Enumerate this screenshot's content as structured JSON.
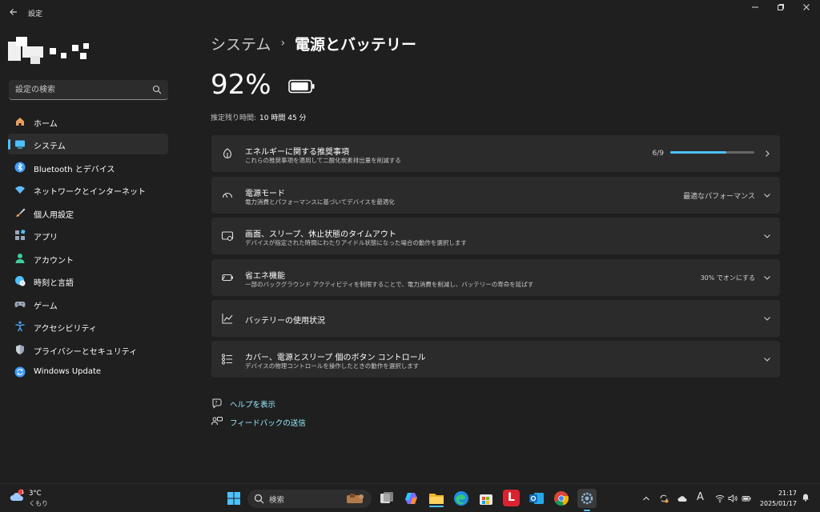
{
  "window": {
    "title": "設定",
    "back_icon": "back-arrow-icon",
    "controls": [
      "minimize-icon",
      "restore-icon",
      "close-icon"
    ]
  },
  "sidebar": {
    "search_placeholder": "設定の検索",
    "items": [
      {
        "label": "ホーム",
        "icon": "home-icon",
        "color": "#e8a060"
      },
      {
        "label": "システム",
        "icon": "system-icon",
        "color": "#4cc2ff",
        "active": true
      },
      {
        "label": "Bluetooth とデバイス",
        "icon": "bluetooth-icon",
        "color": "#3b9cff"
      },
      {
        "label": "ネットワークとインターネット",
        "icon": "wifi-icon",
        "color": "#5dbcff"
      },
      {
        "label": "個人用設定",
        "icon": "brush-icon",
        "color": "#e0a060"
      },
      {
        "label": "アプリ",
        "icon": "apps-icon",
        "color": "#9aa8b8"
      },
      {
        "label": "アカウント",
        "icon": "account-icon",
        "color": "#3ecf9e"
      },
      {
        "label": "時刻と言語",
        "icon": "globe-clock-icon",
        "color": "#4cc2ff"
      },
      {
        "label": "ゲーム",
        "icon": "gamepad-icon",
        "color": "#9aa8b8"
      },
      {
        "label": "アクセシビリティ",
        "icon": "accessibility-icon",
        "color": "#4ca8ff"
      },
      {
        "label": "プライバシーとセキュリティ",
        "icon": "shield-icon",
        "color": "#9aa8b8"
      },
      {
        "label": "Windows Update",
        "icon": "update-icon",
        "color": "#3b9cff"
      }
    ]
  },
  "breadcrumb": {
    "parent": "システム",
    "separator": "›",
    "current": "電源とバッテリー"
  },
  "battery": {
    "percent": "92%",
    "level": 0.92,
    "remaining_label": "推定残り時間:",
    "remaining_value": "10 時間 45 分"
  },
  "cards": [
    {
      "title": "エネルギーに関する推奨事項",
      "subtitle": "これらの推奨事項を適用して二酸化炭素排出量を削減する",
      "icon": "leaf-icon",
      "value": "6/9",
      "progress": 0.667,
      "chevron": "chevron-right-icon"
    },
    {
      "title": "電源モード",
      "subtitle": "電力消費とパフォーマンスに基づいてデバイスを最適化",
      "icon": "power-mode-icon",
      "value": "最適なパフォーマンス",
      "chevron": "chevron-down-icon"
    },
    {
      "title": "画面、スリープ、休止状態のタイムアウト",
      "subtitle": "デバイスが指定された時間にわたりアイドル状態になった場合の動作を選択します",
      "icon": "screen-timeout-icon",
      "chevron": "chevron-down-icon"
    },
    {
      "title": "省エネ機能",
      "subtitle": "一部のバックグラウンド アクティビティを制限することで、電力消費を削減し、バッテリーの寿命を延ばす",
      "icon": "battery-saver-icon",
      "value": "30% でオンにする",
      "chevron": "chevron-down-icon"
    },
    {
      "title": "バッテリーの使用状況",
      "icon": "chart-line-icon",
      "chevron": "chevron-down-icon"
    },
    {
      "title": "カバー、電源とスリープ 個のボタン コントロール",
      "subtitle": "デバイスの物理コントロールを操作したときの動作を選択します",
      "icon": "button-controls-icon",
      "chevron": "chevron-down-icon"
    }
  ],
  "links": [
    {
      "label": "ヘルプを表示",
      "icon": "help-icon"
    },
    {
      "label": "フィードバックの送信",
      "icon": "feedback-icon"
    }
  ],
  "taskbar": {
    "weather": {
      "temp": "3°C",
      "condition": "くもり",
      "badge": "1"
    },
    "search_label": "検索",
    "apps": [
      "start-icon",
      "search-icon",
      "widgets-icon",
      "task-view-icon",
      "copilot-icon",
      "file-explorer-icon",
      "edge-icon",
      "store-icon",
      "app-l-icon",
      "outlook-icon",
      "chrome-icon",
      "settings-icon"
    ],
    "tray": [
      "chevron-up-icon",
      "sync-icon",
      "cloud-icon",
      "ime-icon",
      "wifi-icon",
      "volume-icon",
      "battery-icon"
    ],
    "ime_label": "A",
    "time": "21:17",
    "date": "2025/01/17"
  }
}
